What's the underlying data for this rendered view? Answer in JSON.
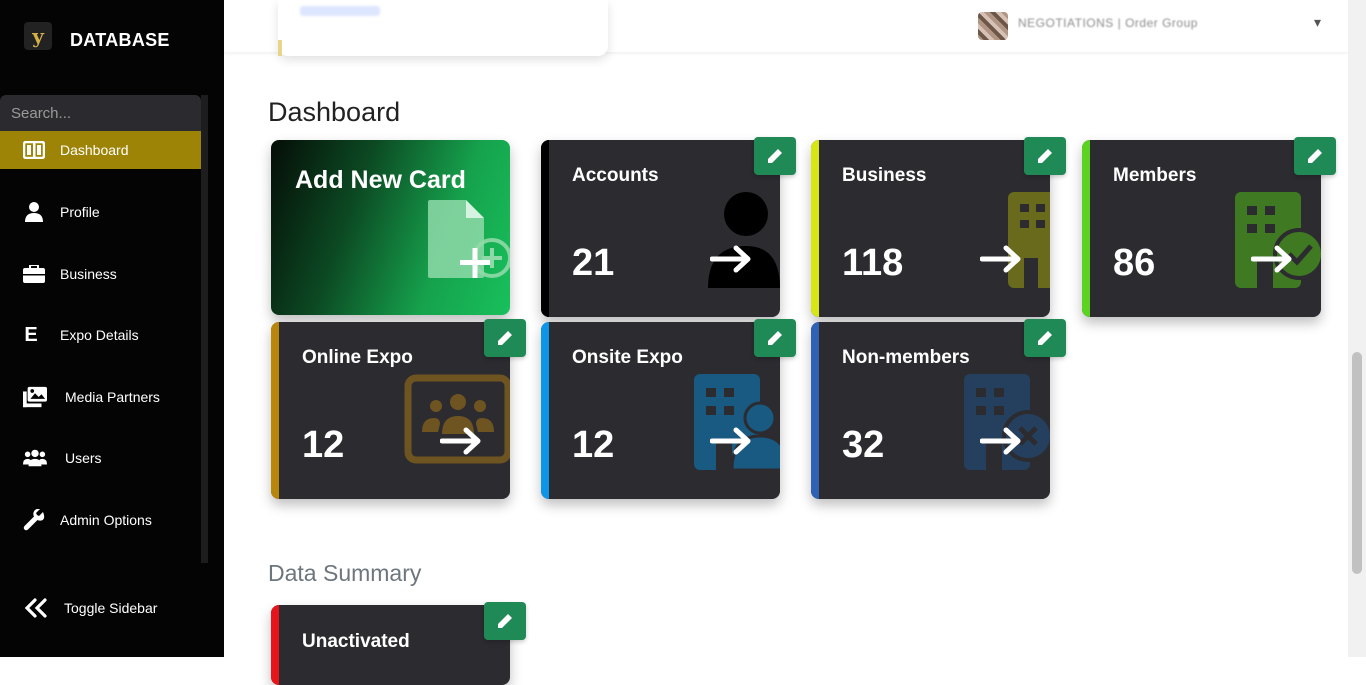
{
  "brand": {
    "title": "DATABASE",
    "logo_letter": "y"
  },
  "sidebar": {
    "search_placeholder": "Search...",
    "items": [
      {
        "label": "Dashboard",
        "icon": "columns-icon",
        "active": true
      },
      {
        "label": "Profile",
        "icon": "user-icon"
      },
      {
        "label": "Business",
        "icon": "briefcase-icon"
      },
      {
        "label": "Expo Details",
        "icon": "letter-e-icon"
      },
      {
        "label": "Media Partners",
        "icon": "images-icon"
      },
      {
        "label": "Users",
        "icon": "users-icon"
      },
      {
        "label": "Admin Options",
        "icon": "wrench-icon"
      }
    ],
    "toggle_label": "Toggle Sidebar",
    "active_color": "#9e8406"
  },
  "header": {
    "user_name": "NEGOTIATIONS | Order Group"
  },
  "main": {
    "dashboard_heading": "Dashboard",
    "add_card_label": "Add New Card",
    "cards": [
      {
        "title": "Accounts",
        "value": "21",
        "accent": "#000000",
        "icon": "user-icon"
      },
      {
        "title": "Business",
        "value": "118",
        "accent": "#d7e615",
        "icon": "building-icon"
      },
      {
        "title": "Members",
        "value": "86",
        "accent": "#5cd321",
        "icon": "building-check-icon"
      },
      {
        "title": "Online Expo",
        "value": "12",
        "accent": "#b8860b",
        "icon": "people-screen-icon"
      },
      {
        "title": "Onsite Expo",
        "value": "12",
        "accent": "#0d95e8",
        "icon": "building-user-icon"
      },
      {
        "title": "Non-members",
        "value": "32",
        "accent": "#2d62b5",
        "icon": "building-x-icon"
      }
    ],
    "summary_heading": "Data Summary",
    "summary_cards": [
      {
        "title": "Unactivated",
        "accent": "#e8141c"
      }
    ]
  }
}
